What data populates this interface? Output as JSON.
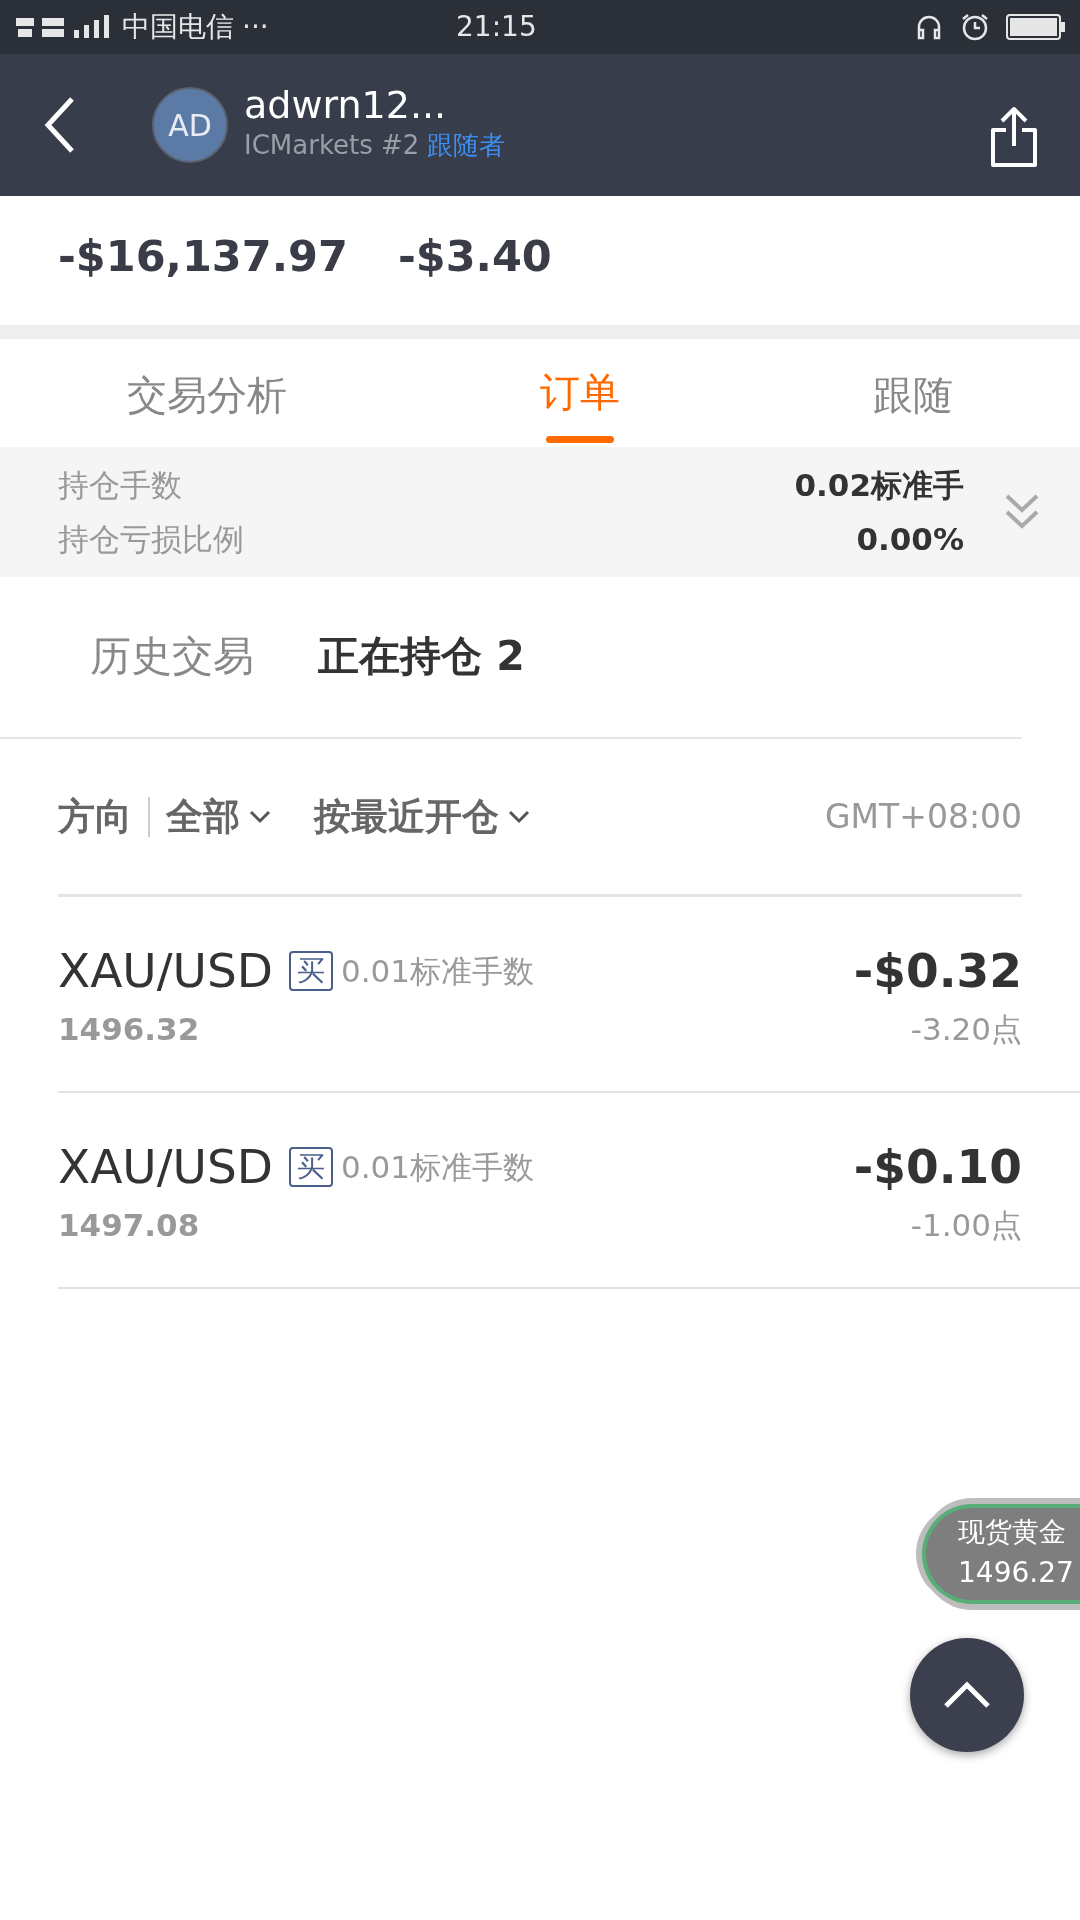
{
  "status_bar": {
    "carrier": "中国电信",
    "dots": "···",
    "time": "21:15"
  },
  "header": {
    "avatar": "AD",
    "name": "adwrn12...",
    "account": "ICMarkets #2",
    "role": "跟随者"
  },
  "summary_values": [
    "-$16,137.97",
    "-$3.40"
  ],
  "tabs": [
    {
      "label": "交易分析",
      "selected": false
    },
    {
      "label": "订单",
      "selected": true
    },
    {
      "label": "跟随",
      "selected": false
    }
  ],
  "stats": [
    {
      "label": "持仓手数",
      "value": "0.02标准手"
    },
    {
      "label": "持仓亏损比例",
      "value": "0.00%"
    }
  ],
  "sub_tabs": [
    {
      "label": "历史交易",
      "selected": false
    },
    {
      "label": "正在持仓 2",
      "selected": true
    }
  ],
  "filters": {
    "label": "方向",
    "direction": "全部",
    "sort": "按最近开仓",
    "timezone": "GMT+08:00"
  },
  "orders": [
    {
      "symbol": "XAU/USD",
      "side": "买",
      "lots": "0.01标准手数",
      "price": "1496.32",
      "profit": "-$0.32",
      "points": "-3.20点"
    },
    {
      "symbol": "XAU/USD",
      "side": "买",
      "lots": "0.01标准手数",
      "price": "1497.08",
      "profit": "-$0.10",
      "points": "-1.00点"
    }
  ],
  "quote": {
    "name": "现货黄金",
    "price": "1496.27"
  }
}
